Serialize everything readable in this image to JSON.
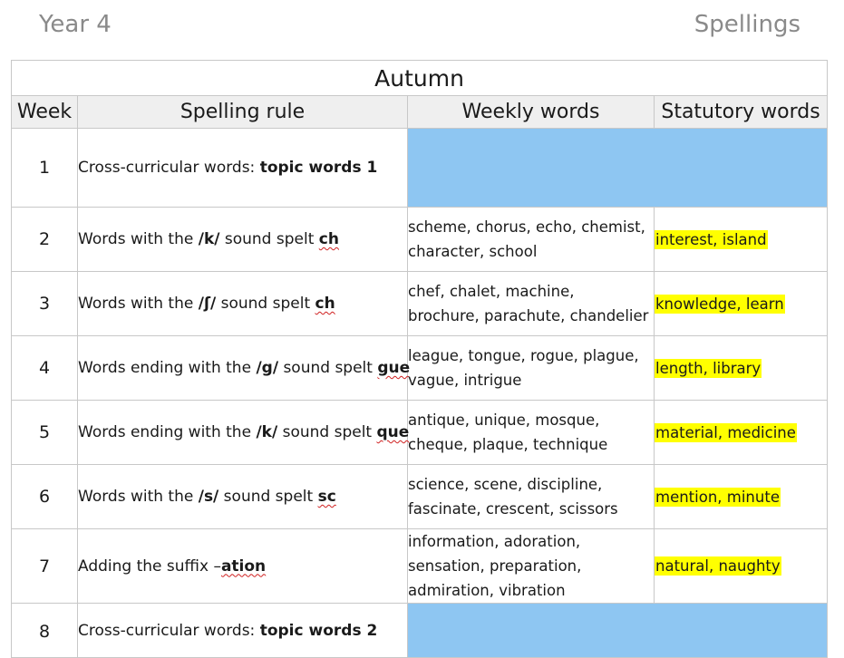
{
  "header": {
    "left": "Year 4",
    "right": "Spellings"
  },
  "table": {
    "title": "Autumn",
    "columns": [
      "Week",
      "Spelling rule",
      "Weekly words",
      "Statutory words"
    ],
    "rows": [
      {
        "week": "1",
        "rule_pre": "Cross-curricular words: ",
        "rule_bold": "topic words 1",
        "rule_mid": "",
        "rule_end": "",
        "words_1": "",
        "words_2": "",
        "words_3": "",
        "statutory": ""
      },
      {
        "week": "2",
        "rule_pre": "Words with the ",
        "rule_bold": "/k/",
        "rule_mid": " sound spelt ",
        "rule_end": "ch",
        "words_1": "scheme, chorus, echo, chemist,",
        "words_2": "character, school",
        "words_3": "",
        "statutory": "interest, island"
      },
      {
        "week": "3",
        "rule_pre": "Words with the ",
        "rule_bold": "/ʃ/",
        "rule_mid": " sound spelt ",
        "rule_end": "ch",
        "words_1": "chef, chalet, machine,",
        "words_2": "brochure, parachute, chandelier",
        "words_3": "",
        "statutory": "knowledge, learn"
      },
      {
        "week": "4",
        "rule_pre": "Words ending with the ",
        "rule_bold": "/g/",
        "rule_mid": " sound spelt ",
        "rule_end": "gue",
        "words_1": "league, tongue, rogue, plague,",
        "words_2": "vague, intrigue",
        "words_3": "",
        "statutory": "length, library"
      },
      {
        "week": "5",
        "rule_pre": "Words ending with the ",
        "rule_bold": "/k/",
        "rule_mid": " sound spelt ",
        "rule_end": "que",
        "words_1": "antique, unique, mosque,",
        "words_2": "cheque, plaque, technique",
        "words_3": "",
        "statutory": "material, medicine"
      },
      {
        "week": "6",
        "rule_pre": "Words with the ",
        "rule_bold": "/s/",
        "rule_mid": " sound spelt ",
        "rule_end": "sc",
        "words_1": "science, scene, discipline,",
        "words_2": "fascinate, crescent, scissors",
        "words_3": "",
        "statutory": "mention, minute"
      },
      {
        "week": "7",
        "rule_pre": "Adding the suffix –",
        "rule_bold": "",
        "rule_mid": "",
        "rule_end": "ation",
        "words_1": "information, adoration,",
        "words_2": "sensation, preparation,",
        "words_3": "admiration, vibration",
        "statutory": "natural, naughty"
      },
      {
        "week": "8",
        "rule_pre": "Cross-curricular words: ",
        "rule_bold": "topic words 2",
        "rule_mid": "",
        "rule_end": "",
        "words_1": "",
        "words_2": "",
        "words_3": "",
        "statutory": ""
      }
    ]
  },
  "colors": {
    "blue_fill": "#8ec6f2",
    "highlight": "#ffff00",
    "header_fill": "#efefef"
  }
}
